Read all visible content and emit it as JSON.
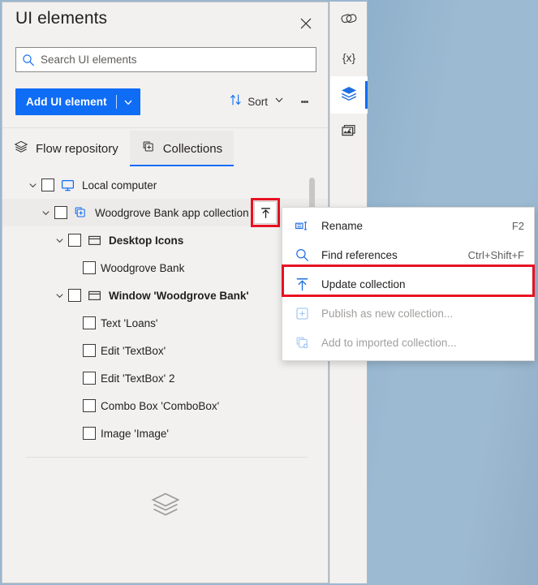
{
  "panel": {
    "title": "UI elements",
    "close_icon": "close-icon"
  },
  "search": {
    "placeholder": "Search UI elements",
    "value": "",
    "icon": "search-icon"
  },
  "toolbar": {
    "add_label": "Add UI element",
    "add_caret_icon": "chevron-down-icon",
    "sort_label": "Sort",
    "sort_icon": "sort-arrows-icon",
    "sort_caret_icon": "chevron-down-icon",
    "more_icon": "more-vertical-icon",
    "accent_color": "#0f6cf5"
  },
  "tabs": [
    {
      "label": "Flow repository",
      "icon": "layers-icon",
      "active": false
    },
    {
      "label": "Collections",
      "icon": "collection-add-icon",
      "active": true
    }
  ],
  "tree": {
    "items": [
      {
        "label": "Local computer",
        "icon": "monitor-icon",
        "indent": 0,
        "twisty": "chevron-down-icon",
        "checkbox": true,
        "bold": false,
        "selected": false,
        "action": null
      },
      {
        "label": "Woodgrove Bank app collection",
        "icon": "collection-add-icon",
        "indent": 1,
        "twisty": "chevron-down-icon",
        "checkbox": true,
        "bold": false,
        "selected": true,
        "action": "update-collection-icon"
      },
      {
        "label": "Desktop Icons",
        "icon": "window-icon",
        "indent": 2,
        "twisty": "chevron-down-icon",
        "checkbox": true,
        "bold": true,
        "selected": false,
        "action": null
      },
      {
        "label": "Woodgrove Bank",
        "icon": null,
        "indent": 3,
        "twisty": null,
        "checkbox": true,
        "bold": false,
        "selected": false,
        "action": null
      },
      {
        "label": "Window 'Woodgrove Bank'",
        "icon": "window-icon",
        "indent": 2,
        "twisty": "chevron-down-icon",
        "checkbox": true,
        "bold": true,
        "selected": false,
        "action": null
      },
      {
        "label": "Text 'Loans'",
        "icon": null,
        "indent": 3,
        "twisty": null,
        "checkbox": true,
        "bold": false,
        "selected": false,
        "action": null
      },
      {
        "label": "Edit 'TextBox'",
        "icon": null,
        "indent": 3,
        "twisty": null,
        "checkbox": true,
        "bold": false,
        "selected": false,
        "action": null
      },
      {
        "label": "Edit 'TextBox' 2",
        "icon": null,
        "indent": 3,
        "twisty": null,
        "checkbox": true,
        "bold": false,
        "selected": false,
        "action": null
      },
      {
        "label": "Combo Box 'ComboBox'",
        "icon": null,
        "indent": 3,
        "twisty": null,
        "checkbox": true,
        "bold": false,
        "selected": false,
        "action": null
      },
      {
        "label": "Image 'Image'",
        "icon": null,
        "indent": 3,
        "twisty": null,
        "checkbox": true,
        "bold": false,
        "selected": false,
        "action": null
      }
    ],
    "watermark_icon": "layers-icon"
  },
  "context_menu": {
    "items": [
      {
        "label": "Rename",
        "shortcut": "F2",
        "icon": "rename-icon",
        "disabled": false,
        "highlighted": false
      },
      {
        "label": "Find references",
        "shortcut": "Ctrl+Shift+F",
        "icon": "search-icon",
        "disabled": false,
        "highlighted": false
      },
      {
        "label": "Update collection",
        "shortcut": "",
        "icon": "update-collection-icon",
        "disabled": false,
        "highlighted": true
      },
      {
        "label": "Publish as new collection...",
        "shortcut": "",
        "icon": "plus-box-icon",
        "disabled": true,
        "highlighted": false
      },
      {
        "label": "Add to imported collection...",
        "shortcut": "",
        "icon": "collection-add-icon",
        "disabled": true,
        "highlighted": false
      }
    ],
    "highlight_color": "#e81123"
  },
  "rail": {
    "items": [
      {
        "icon": "ui-elements-icon",
        "active": false
      },
      {
        "icon": "variables-icon",
        "label": "{x}",
        "active": false
      },
      {
        "icon": "layers-icon",
        "active": true
      },
      {
        "icon": "image-icon",
        "active": false
      }
    ]
  }
}
